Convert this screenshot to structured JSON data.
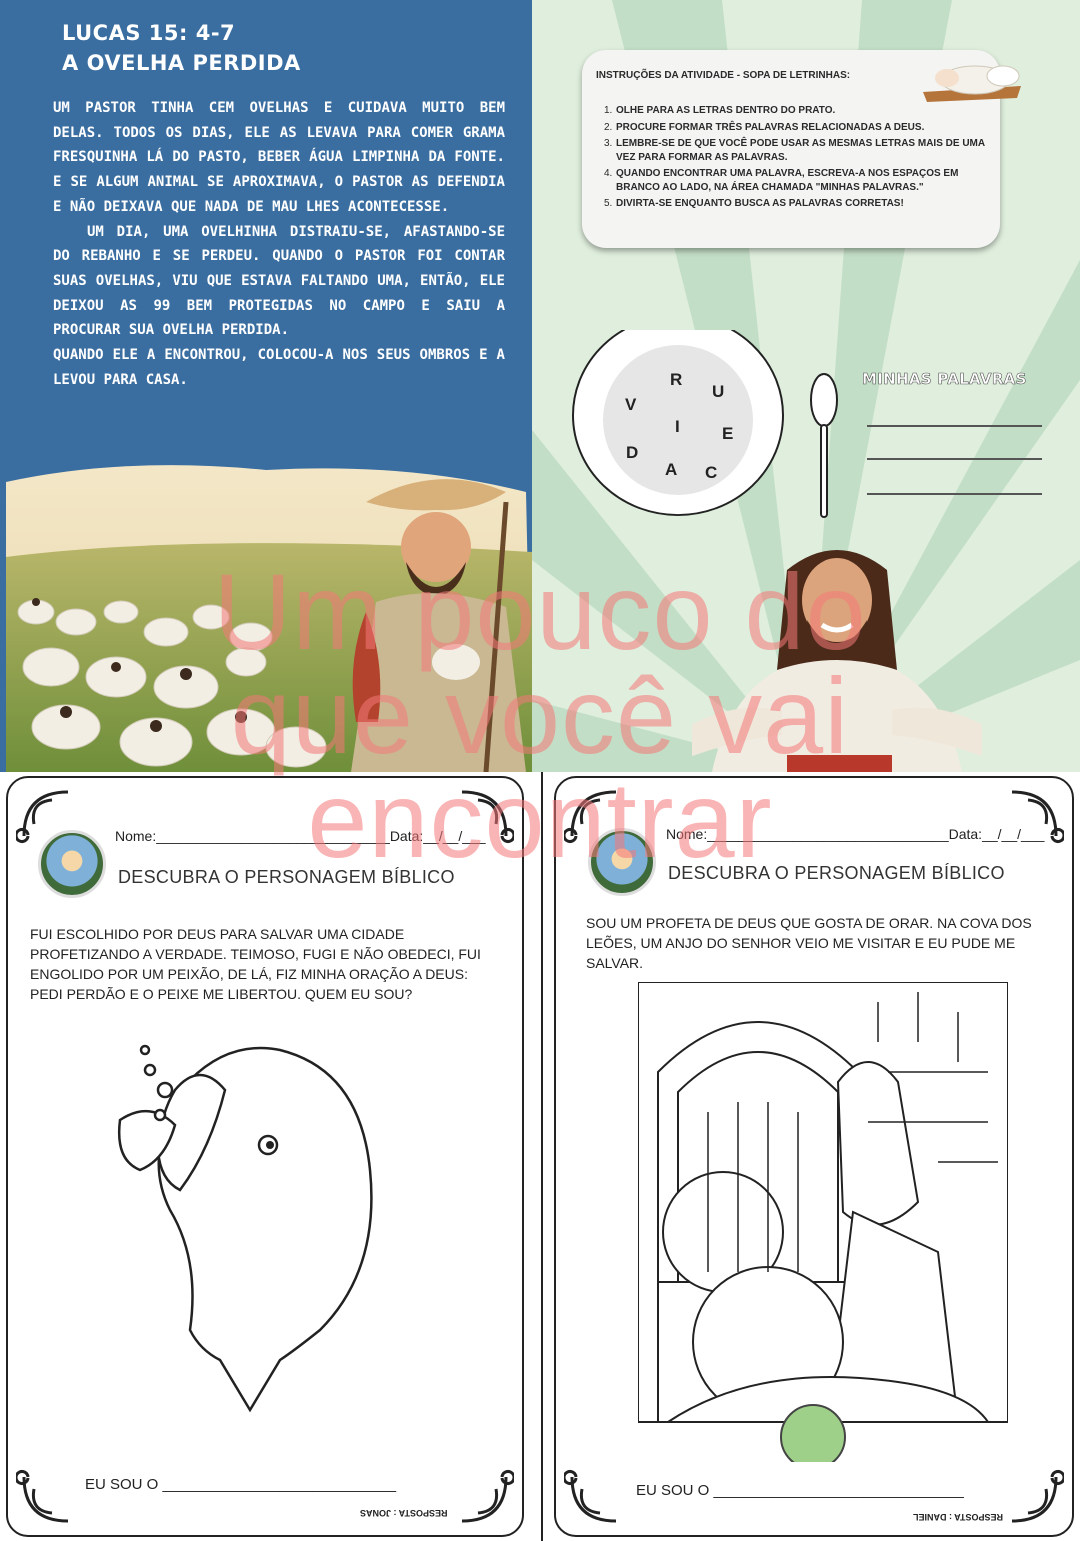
{
  "story": {
    "reference": "LUCAS 15: 4-7",
    "title": "A OVELHA PERDIDA",
    "paragraphs": [
      "UM PASTOR TINHA CEM OVELHAS E CUIDAVA MUITO BEM DELAS. TODOS OS DIAS, ELE AS LEVAVA PARA COMER GRAMA FRESQUINHA LÁ DO PASTO, BEBER ÁGUA LIMPINHA DA FONTE. E SE ALGUM ANIMAL SE APROXIMAVA, O PASTOR AS DEFENDIA E NÃO DEIXAVA QUE NADA DE MAU LHES ACONTECESSE.",
      "UM DIA, UMA OVELHINHA DISTRAIU-SE, AFASTANDO-SE DO REBANHO E SE PERDEU. QUANDO O PASTOR FOI CONTAR SUAS OVELHAS, VIU QUE ESTAVA FALTANDO UMA, ENTÃO, ELE DEIXOU AS 99 BEM PROTEGIDAS NO CAMPO E SAIU A PROCURAR SUA OVELHA PERDIDA.",
      "QUANDO ELE A ENCONTROU, COLOCOU-A NOS SEUS OMBROS E A LEVOU PARA CASA."
    ]
  },
  "activity": {
    "instructions_title": "INSTRUÇÕES DA ATIVIDADE - SOPA DE LETRINHAS:",
    "instructions": [
      {
        "n": "1.",
        "text": "OLHE PARA AS LETRAS DENTRO DO PRATO."
      },
      {
        "n": "2.",
        "text": "PROCURE FORMAR TRÊS PALAVRAS RELACIONADAS A DEUS."
      },
      {
        "n": "3.",
        "text": "LEMBRE-SE DE QUE VOCÊ PODE USAR AS MESMAS LETRAS MAIS DE UMA VEZ PARA FORMAR AS PALAVRAS."
      },
      {
        "n": "4.",
        "text": "QUANDO ENCONTRAR UMA PALAVRA, ESCREVA-A NOS ESPAÇOS EM BRANCO AO LADO, NA ÁREA CHAMADA \"MINHAS PALAVRAS.\""
      },
      {
        "n": "5.",
        "text": "DIVIRTA-SE ENQUANTO BUSCA AS PALAVRAS CORRETAS!"
      }
    ],
    "plate_letters": [
      "R",
      "U",
      "V",
      "I",
      "E",
      "D",
      "A",
      "C"
    ],
    "words_title": "MINHAS PALAVRAS"
  },
  "sheet_left": {
    "name_label": "Nome:______________________________Data:__/__/___",
    "heading": "DESCUBRA O PERSONAGEM BÍBLICO",
    "clue": "FUI ESCOLHIDO POR DEUS PARA SALVAR UMA CIDADE PROFETIZANDO A VERDADE. TEIMOSO, FUGI E NÃO OBEDECI, FUI ENGOLIDO POR UM PEIXÃO, DE LÁ, FIZ MINHA ORAÇÃO A DEUS: PEDI PERDÃO E O PEIXE ME LIBERTOU. QUEM EU SOU?",
    "answer_line": "EU SOU O ____________________________",
    "answer_key": "RESPOSTA : JONAS"
  },
  "sheet_right": {
    "name_label": "Nome:_______________________________Data:__/__/___",
    "heading": "DESCUBRA O PERSONAGEM BÍBLICO",
    "clue": "SOU UM PROFETA DE DEUS QUE GOSTA DE ORAR. NA COVA DOS LEÕES, UM ANJO DO SENHOR VEIO ME VISITAR E EU PUDE ME SALVAR.",
    "answer_line": "EU SOU O ______________________________",
    "answer_key": "RESPOSTA : DANIEL"
  },
  "watermark": [
    "Um pouco do",
    "que você vai",
    "encontrar"
  ],
  "colors": {
    "story_bg": "#3a6ea1",
    "activity_bg": "#dfeedd",
    "watermark": "#f47878"
  }
}
